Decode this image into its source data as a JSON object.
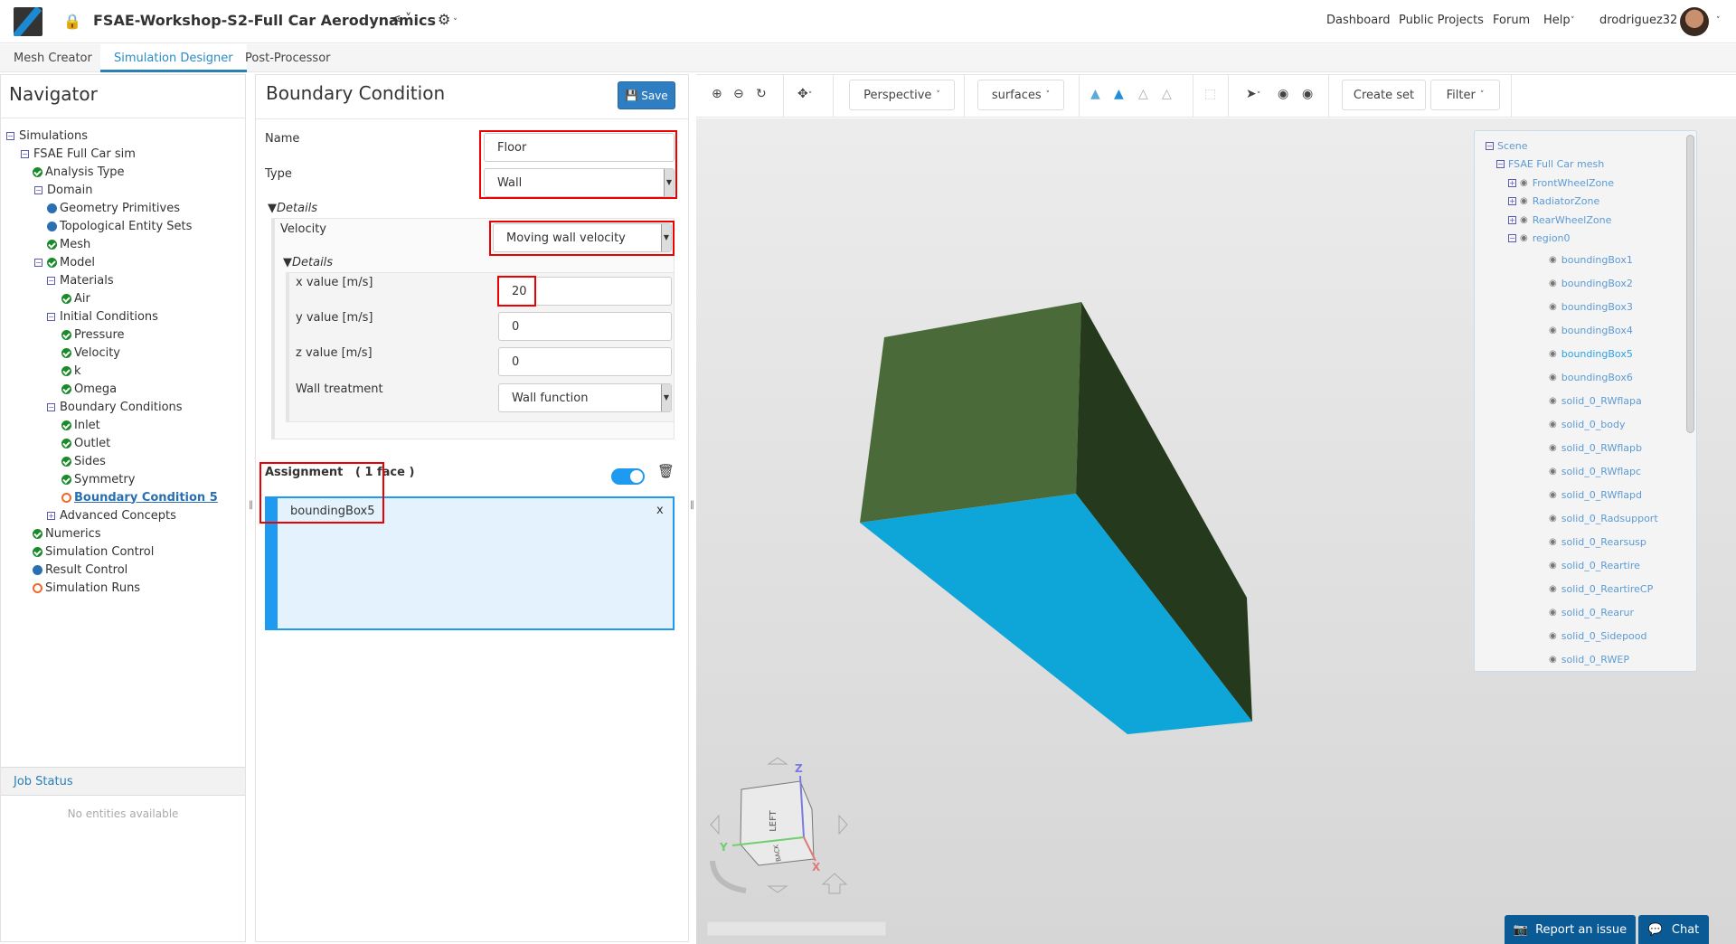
{
  "header": {
    "title": "FSAE-Workshop-S2-Full Car Aerodynamics",
    "links": [
      "Dashboard",
      "Public Projects",
      "Forum",
      "Help"
    ],
    "username": "drodriguez32"
  },
  "tabs": [
    {
      "label": "Mesh Creator",
      "active": false
    },
    {
      "label": "Simulation Designer",
      "active": true
    },
    {
      "label": "Post-Processor",
      "active": false
    }
  ],
  "navigator": {
    "title": "Navigator",
    "items": [
      {
        "label": "Simulations",
        "level": 0,
        "expander": "minus",
        "status": null
      },
      {
        "label": "FSAE Full Car sim",
        "level": 1,
        "expander": "minus",
        "status": null
      },
      {
        "label": "Analysis Type",
        "level": 2,
        "expander": null,
        "status": "check"
      },
      {
        "label": "Domain",
        "level": 2,
        "expander": "minus",
        "status": null
      },
      {
        "label": "Geometry Primitives",
        "level": 3,
        "expander": null,
        "status": "dot"
      },
      {
        "label": "Topological Entity Sets",
        "level": 3,
        "expander": null,
        "status": "dot"
      },
      {
        "label": "Mesh",
        "level": 3,
        "expander": null,
        "status": "check"
      },
      {
        "label": "Model",
        "level": 2,
        "expander": "minus",
        "status": "check"
      },
      {
        "label": "Materials",
        "level": 3,
        "expander": "minus",
        "status": null
      },
      {
        "label": "Air",
        "level": 4,
        "expander": null,
        "status": "check"
      },
      {
        "label": "Initial Conditions",
        "level": 3,
        "expander": "minus",
        "status": null
      },
      {
        "label": "Pressure",
        "level": 4,
        "expander": null,
        "status": "check"
      },
      {
        "label": "Velocity",
        "level": 4,
        "expander": null,
        "status": "check"
      },
      {
        "label": "k",
        "level": 4,
        "expander": null,
        "status": "check"
      },
      {
        "label": "Omega",
        "level": 4,
        "expander": null,
        "status": "check"
      },
      {
        "label": "Boundary Conditions",
        "level": 3,
        "expander": "minus",
        "status": null
      },
      {
        "label": "Inlet",
        "level": 4,
        "expander": null,
        "status": "check"
      },
      {
        "label": "Outlet",
        "level": 4,
        "expander": null,
        "status": "check"
      },
      {
        "label": "Sides",
        "level": 4,
        "expander": null,
        "status": "check"
      },
      {
        "label": "Symmetry",
        "level": 4,
        "expander": null,
        "status": "check"
      },
      {
        "label": "Boundary Condition 5",
        "level": 4,
        "expander": null,
        "status": "ring",
        "selected": true
      },
      {
        "label": "Advanced Concepts",
        "level": 3,
        "expander": "plus",
        "status": null
      },
      {
        "label": "Numerics",
        "level": 2,
        "expander": null,
        "status": "check"
      },
      {
        "label": "Simulation Control",
        "level": 2,
        "expander": null,
        "status": "check"
      },
      {
        "label": "Result Control",
        "level": 2,
        "expander": null,
        "status": "dot"
      },
      {
        "label": "Simulation Runs",
        "level": 2,
        "expander": null,
        "status": "ring"
      }
    ]
  },
  "job_status": {
    "title": "Job Status",
    "empty": "No entities available"
  },
  "bc": {
    "title": "Boundary Condition",
    "save": "Save",
    "name_label": "Name",
    "name_value": "Floor",
    "type_label": "Type",
    "type_value": "Wall",
    "details": "Details",
    "velocity_label": "Velocity",
    "velocity_value": "Moving wall velocity",
    "details2": "Details",
    "x_label": "x value [m/s]",
    "x_value": "20",
    "y_label": "y value [m/s]",
    "y_value": "0",
    "z_label": "z value [m/s]",
    "z_value": "0",
    "wall_label": "Wall treatment",
    "wall_value": "Wall function",
    "assignment": "Assignment   ( 1 face )",
    "assignment_enabled": true,
    "assigned": [
      "boundingBox5"
    ],
    "remove": "x"
  },
  "toolbar": {
    "perspective": "Perspective",
    "surfaces": "surfaces",
    "create_set": "Create set",
    "filter": "Filter"
  },
  "scene": {
    "items": [
      {
        "label": "Scene",
        "level": 0,
        "expander": "minus",
        "eye": false
      },
      {
        "label": "FSAE Full Car mesh",
        "level": 1,
        "expander": "minus",
        "eye": false
      },
      {
        "label": "FrontWheelZone",
        "level": 2,
        "expander": "plus",
        "eye": true
      },
      {
        "label": "RadiatorZone",
        "level": 2,
        "expander": "plus",
        "eye": true
      },
      {
        "label": "RearWheelZone",
        "level": 2,
        "expander": "plus",
        "eye": true
      },
      {
        "label": "region0",
        "level": 2,
        "expander": "minus",
        "eye": true
      },
      {
        "label": "boundingBox1",
        "level": 3,
        "eye": true
      },
      {
        "label": "boundingBox2",
        "level": 3,
        "eye": true
      },
      {
        "label": "boundingBox3",
        "level": 3,
        "eye": true
      },
      {
        "label": "boundingBox4",
        "level": 3,
        "eye": true
      },
      {
        "label": "boundingBox5",
        "level": 3,
        "eye": true,
        "highlighted": true
      },
      {
        "label": "boundingBox6",
        "level": 3,
        "eye": true
      },
      {
        "label": "solid_0_RWflapa",
        "level": 3,
        "eye": true
      },
      {
        "label": "solid_0_body",
        "level": 3,
        "eye": true
      },
      {
        "label": "solid_0_RWflapb",
        "level": 3,
        "eye": true
      },
      {
        "label": "solid_0_RWflapc",
        "level": 3,
        "eye": true
      },
      {
        "label": "solid_0_RWflapd",
        "level": 3,
        "eye": true
      },
      {
        "label": "solid_0_Radsupport",
        "level": 3,
        "eye": true
      },
      {
        "label": "solid_0_Rearsusp",
        "level": 3,
        "eye": true
      },
      {
        "label": "solid_0_Reartire",
        "level": 3,
        "eye": true
      },
      {
        "label": "solid_0_ReartireCP",
        "level": 3,
        "eye": true
      },
      {
        "label": "solid_0_Rearur",
        "level": 3,
        "eye": true
      },
      {
        "label": "solid_0_Sidepood",
        "level": 3,
        "eye": true
      },
      {
        "label": "solid_0_RWEP",
        "level": 3,
        "eye": true
      }
    ]
  },
  "viewcube": {
    "face_left": "LEFT",
    "face_bottom": "BACK",
    "axis_x": "X",
    "axis_y": "Y",
    "axis_z": "Z"
  },
  "footer": {
    "report": "Report an issue",
    "chat": "Chat"
  },
  "colors": {
    "accent": "#2a7fb5",
    "box_top": "#4a6a3a",
    "box_side": "#253a1c",
    "box_selected_face": "#0ea5d8",
    "assignment_bg": "#e3f2fc",
    "assignment_border": "#1e9bf0"
  }
}
